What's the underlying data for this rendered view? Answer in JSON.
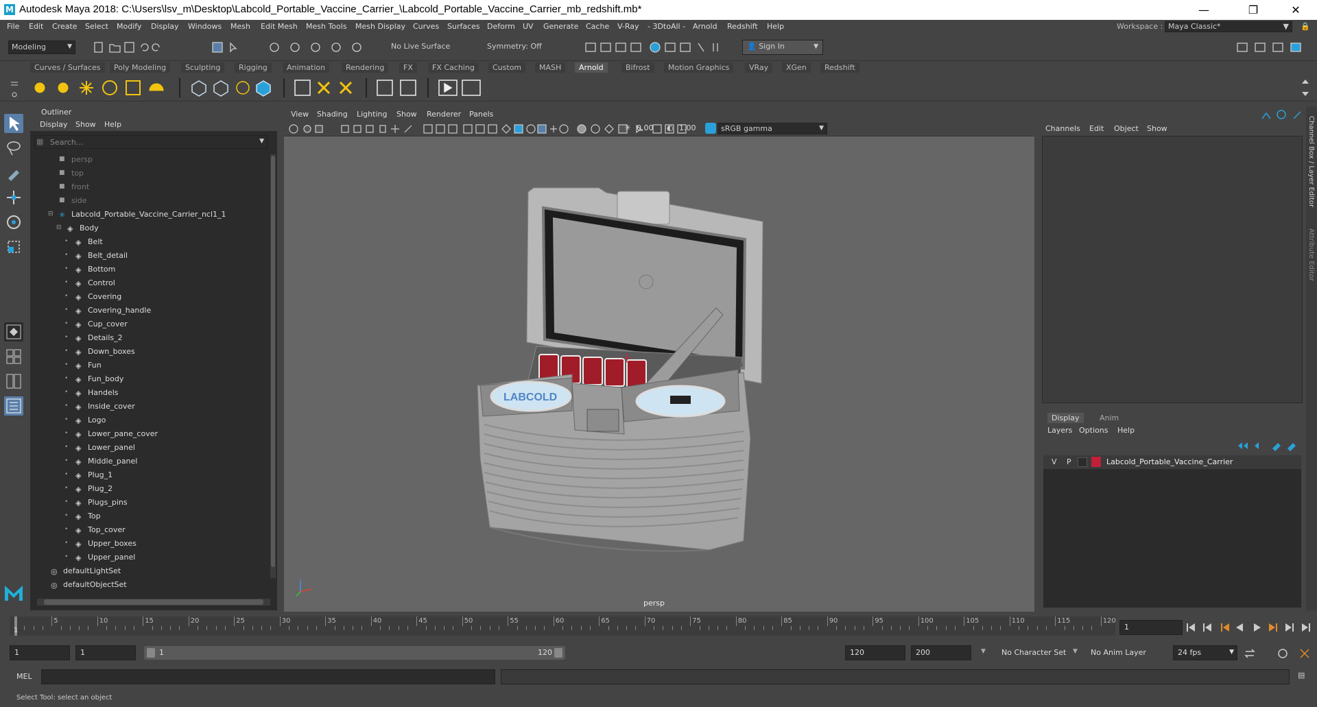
{
  "window": {
    "title": "Autodesk Maya 2018: C:\\Users\\lsv_m\\Desktop\\Labcold_Portable_Vaccine_Carrier_\\Labcold_Portable_Vaccine_Carrier_mb_redshift.mb*"
  },
  "menubar": {
    "items": [
      "File",
      "Edit",
      "Create",
      "Select",
      "Modify",
      "Display",
      "Windows",
      "Mesh",
      "Edit Mesh",
      "Mesh Tools",
      "Mesh Display",
      "Curves",
      "Surfaces",
      "Deform",
      "UV",
      "Generate",
      "Cache",
      "V-Ray",
      "- 3DtoAll -",
      "Arnold",
      "Redshift",
      "Help"
    ],
    "workspace_label": "Workspace :",
    "workspace_value": "Maya Classic*"
  },
  "statusline": {
    "mode": "Modeling",
    "live_surface": "No Live Surface",
    "symmetry": "Symmetry: Off",
    "sign_in": "Sign In"
  },
  "shelf": {
    "tabs": [
      "Curves / Surfaces",
      "Poly Modeling",
      "Sculpting",
      "Rigging",
      "Animation",
      "Rendering",
      "FX",
      "FX Caching",
      "Custom",
      "MASH",
      "Arnold",
      "Bifrost",
      "Motion Graphics",
      "VRay",
      "XGen",
      "Redshift"
    ],
    "active": "Arnold"
  },
  "outliner": {
    "title": "Outliner",
    "menus": [
      "Display",
      "Show",
      "Help"
    ],
    "search_placeholder": "Search...",
    "cameras": [
      "persp",
      "top",
      "front",
      "side"
    ],
    "root": "Labcold_Portable_Vaccine_Carrier_ncl1_1",
    "group": "Body",
    "children": [
      "Belt",
      "Belt_detail",
      "Bottom",
      "Control",
      "Covering",
      "Covering_handle",
      "Cup_cover",
      "Details_2",
      "Down_boxes",
      "Fun",
      "Fun_body",
      "Handels",
      "Inside_cover",
      "Logo",
      "Lower_pane_cover",
      "Lower_panel",
      "Middle_panel",
      "Plug_1",
      "Plug_2",
      "Plugs_pins",
      "Top",
      "Top_cover",
      "Upper_boxes",
      "Upper_panel"
    ],
    "sets": [
      "defaultLightSet",
      "defaultObjectSet"
    ]
  },
  "viewport": {
    "menus": [
      "View",
      "Shading",
      "Lighting",
      "Show",
      "Renderer",
      "Panels"
    ],
    "exposure": "0.00",
    "gamma": "1.00",
    "colorspace": "sRGB gamma",
    "camera_label": "persp",
    "logo_text": "LABCOLD"
  },
  "channelbox": {
    "menus": [
      "Channels",
      "Edit",
      "Object",
      "Show"
    ],
    "side_tab_1": "Channel Box / Layer Editor",
    "side_tab_2": "Attribute Editor"
  },
  "layereditor": {
    "tabs": [
      "Display",
      "Anim"
    ],
    "menus": [
      "Layers",
      "Options",
      "Help"
    ],
    "layer": {
      "v": "V",
      "p": "P",
      "name": "Labcold_Portable_Vaccine_Carrier",
      "color": "#c0203a"
    }
  },
  "timeline": {
    "ticks": [
      "5",
      "10",
      "15",
      "20",
      "25",
      "30",
      "35",
      "40",
      "45",
      "50",
      "55",
      "60",
      "65",
      "70",
      "75",
      "80",
      "85",
      "90",
      "95",
      "100",
      "105",
      "110",
      "115",
      "120"
    ],
    "start_marker": "1",
    "current_frame": "1"
  },
  "range": {
    "start": "1",
    "anim_start": "1",
    "slider_start": "1",
    "slider_end": "120",
    "end": "120",
    "anim_end": "200",
    "character_set": "No Character Set",
    "anim_layer": "No Anim Layer",
    "fps": "24 fps"
  },
  "cmdline": {
    "label": "MEL"
  },
  "helpline": {
    "text": "Select Tool: select an object"
  }
}
